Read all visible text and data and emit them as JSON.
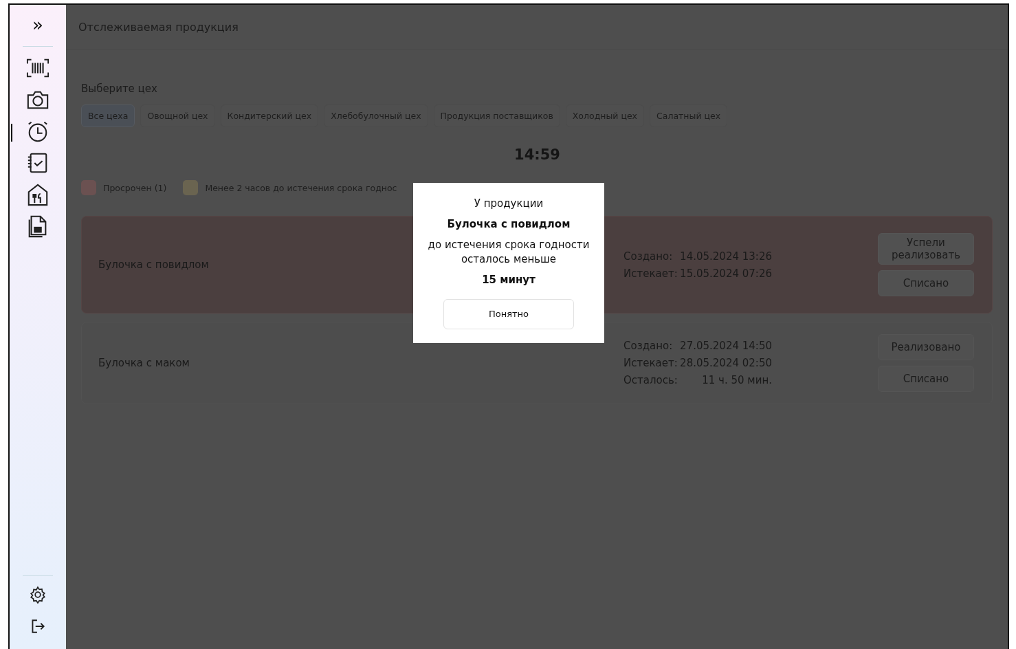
{
  "sidebar": {
    "expand_icon": "»",
    "nav_items": [
      {
        "selected": false
      },
      {
        "selected": false
      },
      {
        "selected": true
      },
      {
        "selected": false
      },
      {
        "selected": false
      },
      {
        "selected": false
      }
    ]
  },
  "header": {
    "title": "Отслеживаемая продукция"
  },
  "workshops": {
    "label": "Выберите цех",
    "tabs": [
      {
        "label": "Все цеха",
        "selected": true
      },
      {
        "label": "Овощной цех",
        "selected": false
      },
      {
        "label": "Кондитерский цех",
        "selected": false
      },
      {
        "label": "Хлебобулочный цех",
        "selected": false
      },
      {
        "label": "Продукция поставщиков",
        "selected": false
      },
      {
        "label": "Холодный цех",
        "selected": false
      },
      {
        "label": "Салатный цех",
        "selected": false
      }
    ]
  },
  "clock": "14:59",
  "legend": [
    {
      "label": "Просрочен (1)",
      "color": "#6b5151"
    },
    {
      "label": "Менее 2 часов до истечения срока годнос",
      "color": "#6a6450"
    }
  ],
  "products": [
    {
      "name": "Булочка с повидлом",
      "expired": true,
      "fields": [
        {
          "label": "Создано:",
          "value": "14.05.2024 13:26"
        },
        {
          "label": "Истекает:",
          "value": "15.05.2024 07:26"
        }
      ],
      "buttons": [
        "Успели реализовать",
        "Списано"
      ]
    },
    {
      "name": "Булочка с маком",
      "expired": false,
      "fields": [
        {
          "label": "Создано:",
          "value": "27.05.2024 14:50"
        },
        {
          "label": "Истекает:",
          "value": "28.05.2024 02:50"
        },
        {
          "label": "Осталось:",
          "value": "11 ч. 50 мин."
        }
      ],
      "buttons": [
        "Реализовано",
        "Списано"
      ]
    }
  ],
  "dialog": {
    "lines": [
      "У продукции",
      "Булочка с повидлом",
      "до истечения срока годности осталось меньше",
      "15 минут"
    ],
    "button": "Понятно"
  }
}
